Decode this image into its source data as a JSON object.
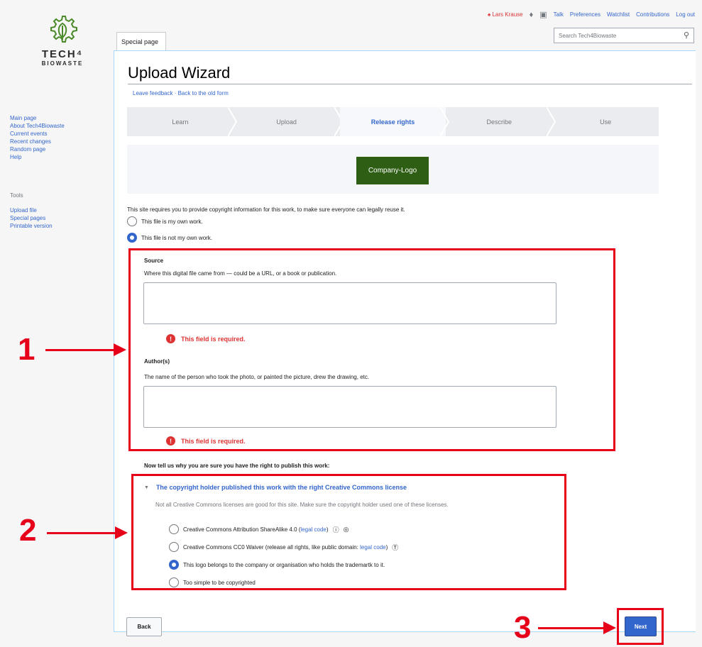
{
  "logo": {
    "line1": "TECH⁴",
    "line2": "BIOWASTE"
  },
  "nav": {
    "main": [
      "Main page",
      "About Tech4Biowaste",
      "Current events",
      "Recent changes",
      "Random page",
      "Help"
    ],
    "tools_heading": "Tools",
    "tools": [
      "Upload file",
      "Special pages",
      "Printable version"
    ]
  },
  "personal": {
    "user": "Lars Krause",
    "links": [
      "Talk",
      "Preferences",
      "Watchlist",
      "Contributions",
      "Log out"
    ]
  },
  "tab": "Special page",
  "search": {
    "placeholder": "Search Tech4Biowaste"
  },
  "page": {
    "title": "Upload Wizard",
    "subtitle": "Leave feedback · Back to the old form"
  },
  "steps": [
    {
      "label": "Learn",
      "active": false
    },
    {
      "label": "Upload",
      "active": false
    },
    {
      "label": "Release rights",
      "active": true
    },
    {
      "label": "Describe",
      "active": false
    },
    {
      "label": "Use",
      "active": false
    }
  ],
  "preview_label": "Company-Logo",
  "intro": "This site requires you to provide copyright information for this work, to make sure everyone can legally reuse it.",
  "own_work": {
    "own": "This file is my own work.",
    "not_own": "This file is not my own work."
  },
  "source": {
    "label": "Source",
    "help": "Where this digital file came from — could be a URL, or a book or publication.",
    "value": "",
    "error": "This field is required."
  },
  "author": {
    "label": "Author(s)",
    "help": "The name of the person who took the photo, or painted the picture, drew the drawing, etc.",
    "value": "",
    "error": "This field is required."
  },
  "reason_heading": "Now tell us why you are sure you have the right to publish this work:",
  "license": {
    "toggle": "The copyright holder published this work with the right Creative Commons license",
    "note": "Not all Creative Commons licenses are good for this site. Make sure the copyright holder used one of these licenses.",
    "opt1_text": "Creative Commons Attribution ShareAlike 4.0 (",
    "opt1_link": "legal code",
    "opt1_close": ")",
    "opt2_text": "Creative Commons CC0 Waiver (release all rights, like public domain: ",
    "opt2_link": "legal code",
    "opt2_close": ")",
    "opt3": "This logo belongs to the company or organisation who holds the trademartk to it.",
    "opt4": "Too simple to be copyrighted",
    "selected": 3
  },
  "buttons": {
    "back": "Back",
    "next": "Next"
  },
  "callouts": [
    "1",
    "2",
    "3"
  ],
  "colors": {
    "accent": "#3366cc",
    "error": "#d33",
    "callout": "#e6001a",
    "preview": "#2e5e14"
  }
}
